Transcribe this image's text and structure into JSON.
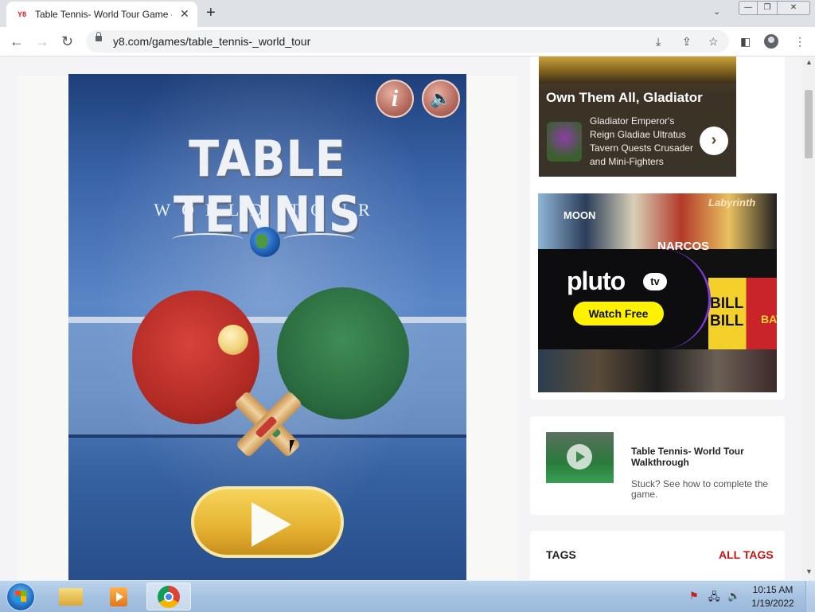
{
  "browser": {
    "tab_title": "Table Tennis- World Tour Game -",
    "tab_favicon": "Y8",
    "tab_close": "✕",
    "new_tab": "+",
    "tab_search": "⌄",
    "url": "y8.com/games/table_tennis-_world_tour",
    "window_controls": {
      "minimize": "—",
      "maximize": "❐",
      "close": "✕"
    },
    "nav": {
      "back": "←",
      "forward": "→",
      "reload": "↻"
    },
    "icons": [
      "install-icon",
      "share-icon",
      "bookmark-star-icon",
      "side-panel-icon",
      "profile-icon",
      "menu-icon"
    ]
  },
  "game": {
    "title": "TABLE TENNIS",
    "subtitle": "WORLD TOUR",
    "info_button": "i",
    "sound_button": "🔈"
  },
  "sidebar": {
    "gladiator_ad": {
      "title": "Own Them All, Gladiator",
      "text": "Gladiator Emperor's Reign Gladiae Ultratus Tavern Quests Crusader and Mini-Fighters",
      "arrow": "›"
    },
    "pluto_ad": {
      "logo": "pluto",
      "logo_tv": "tv",
      "cta": "Watch Free",
      "posters": [
        "MOON",
        "NARCOS",
        "Labyrinth",
        "BILL",
        "BILL",
        "BAT"
      ],
      "brand_color": "#fff200"
    },
    "walkthrough": {
      "title": "Table Tennis- World Tour Walkthrough",
      "description": "Stuck? See how to complete the game."
    },
    "tags": {
      "title": "TAGS",
      "all_tags": "ALL TAGS",
      "accent": "#c91313"
    }
  },
  "taskbar": {
    "time": "10:15 AM",
    "date": "1/19/2022",
    "apps": [
      "windows-explorer",
      "windows-media-player",
      "google-chrome"
    ]
  }
}
